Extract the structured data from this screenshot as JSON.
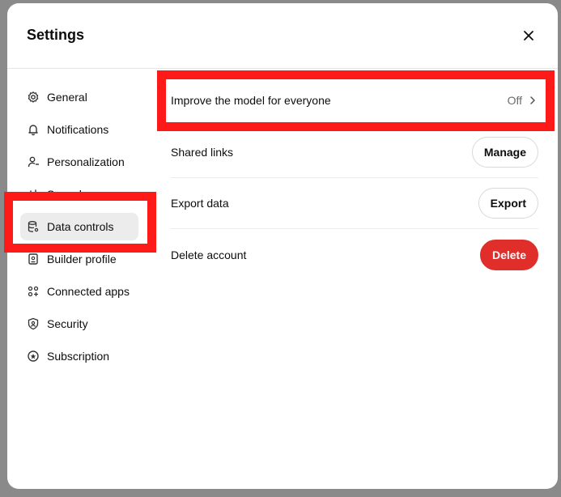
{
  "dialog": {
    "title": "Settings",
    "close_icon": "close-icon"
  },
  "sidebar": {
    "items": [
      {
        "label": "General",
        "icon": "gear-icon"
      },
      {
        "label": "Notifications",
        "icon": "bell-icon"
      },
      {
        "label": "Personalization",
        "icon": "person-icon"
      },
      {
        "label": "Speech",
        "icon": "waveform-icon"
      },
      {
        "label": "Data controls",
        "icon": "database-icon",
        "active": true
      },
      {
        "label": "Builder profile",
        "icon": "id-card-icon"
      },
      {
        "label": "Connected apps",
        "icon": "apps-grid-icon"
      },
      {
        "label": "Security",
        "icon": "shield-icon"
      },
      {
        "label": "Subscription",
        "icon": "subscription-icon"
      }
    ]
  },
  "data_controls": {
    "improve_model": {
      "label": "Improve the model for everyone",
      "value": "Off"
    },
    "shared_links": {
      "label": "Shared links",
      "button": "Manage"
    },
    "export_data": {
      "label": "Export data",
      "button": "Export"
    },
    "delete_account": {
      "label": "Delete account",
      "button": "Delete"
    }
  },
  "colors": {
    "annotation": "#ff1a1a",
    "danger": "#e02e2a",
    "active_bg": "#ececec"
  }
}
